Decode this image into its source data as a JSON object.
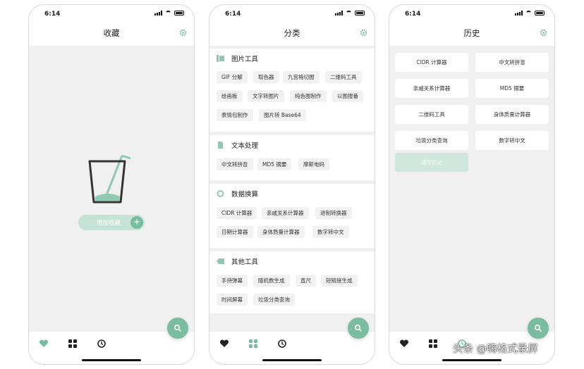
{
  "status": {
    "time": "6:14"
  },
  "accent": "#79bca0",
  "phone1": {
    "title": "收藏",
    "add_favorite_label": "增加收藏",
    "add_favorite_plus": "+",
    "empty_icon": "empty-cup-illustration"
  },
  "phone2": {
    "title": "分类",
    "sections": [
      {
        "title": "图片工具",
        "icon": "image-icon",
        "items": [
          "GIF 分解",
          "取色器",
          "九宫格切图",
          "二维码工具",
          "绘画板",
          "文字转图片",
          "纯色图制作",
          "以图搜番",
          "表情包制作",
          "图片转 Base64"
        ]
      },
      {
        "title": "文本处理",
        "icon": "document-icon",
        "items": [
          "中文转拼音",
          "MD5 摘要",
          "摩斯电码"
        ]
      },
      {
        "title": "数据换算",
        "icon": "pie-icon",
        "items": [
          "CIDR 计算器",
          "亲戚关系计算器",
          "进制转换器",
          "日期计算器",
          "身体质量计算器",
          "数字转中文"
        ]
      },
      {
        "title": "其他工具",
        "icon": "tag-icon",
        "items": [
          "手持弹幕",
          "随机数生成",
          "直尺",
          "短链接生成",
          "时间屏幕",
          "垃圾分类查询"
        ]
      }
    ]
  },
  "phone3": {
    "title": "历史",
    "items": [
      "CIDR 计算器",
      "中文转拼音",
      "亲戚关系计算器",
      "MD5 摘要",
      "二维码工具",
      "身体质量计算器",
      "垃圾分类查询",
      "数字转中文"
    ],
    "clear_label": "清空历史"
  },
  "tabs": [
    "heart-icon",
    "grid-icon",
    "history-icon"
  ],
  "watermark": "头条 @嗨格式录屏"
}
